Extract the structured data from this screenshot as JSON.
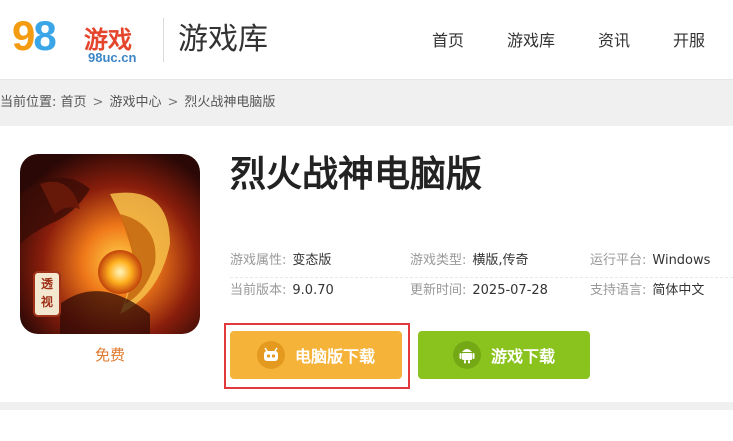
{
  "header": {
    "logo": {
      "number_9": "9",
      "number_8": "8",
      "brand_cn": "游戏",
      "domain": "98uc.cn"
    },
    "section_title": "游戏库",
    "nav": [
      {
        "label": "首页"
      },
      {
        "label": "游戏库"
      },
      {
        "label": "资讯"
      },
      {
        "label": "开服"
      }
    ]
  },
  "breadcrumb": {
    "prefix": "当前位置:",
    "items": [
      "首页",
      "游戏中心",
      "烈火战神电脑版"
    ],
    "separator": ">"
  },
  "game": {
    "title": "烈火战神电脑版",
    "price_label": "免费",
    "icon_stamp": "透视",
    "info": [
      {
        "key": "游戏属性:",
        "value": "变态版"
      },
      {
        "key": "游戏类型:",
        "value": "横版,传奇"
      },
      {
        "key": "运行平台:",
        "value": "Windows"
      },
      {
        "key": "当前版本:",
        "value": "9.0.70"
      },
      {
        "key": "更新时间:",
        "value": "2025-07-28"
      },
      {
        "key": "支持语言:",
        "value": "简体中文"
      }
    ],
    "buttons": {
      "pc_download": "电脑版下载",
      "game_download": "游戏下载"
    }
  },
  "colors": {
    "pc_button": "#f5b33a",
    "game_button": "#8bc31e",
    "highlight_border": "#e23a3a",
    "price": "#e0792d"
  },
  "icons": {
    "pc_button_icon": "robot-icon",
    "game_button_icon": "android-icon"
  }
}
